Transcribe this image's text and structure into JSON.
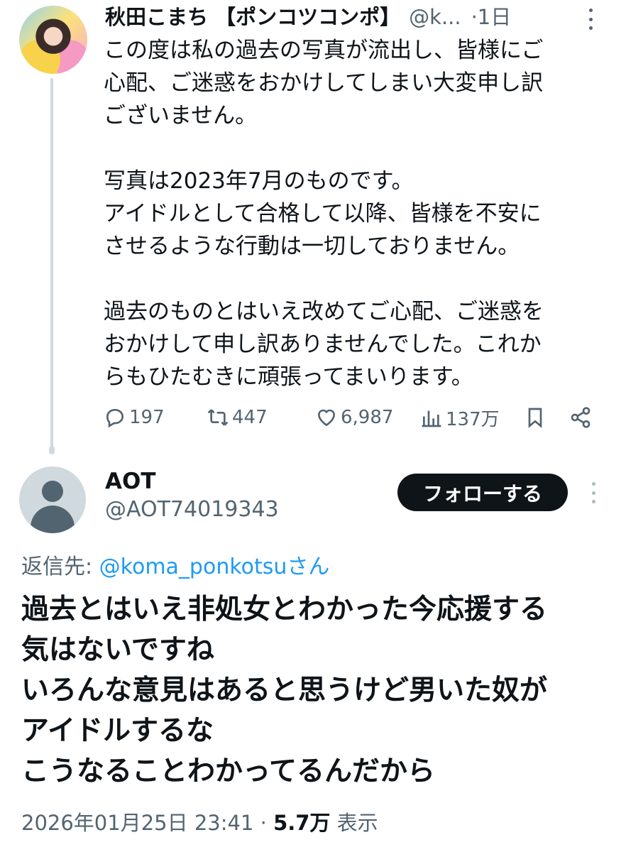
{
  "tweet1": {
    "author_name": "秋田こまち 【ポンコツコンポ】",
    "handle": "@k...",
    "time": "·1日",
    "paragraphs": [
      "この度は私の過去の写真が流出し、皆様にご",
      "心配、ご迷惑をおかけしてしまい大変申し訳",
      "ございません。",
      "",
      "写真は2023年7月のものです。",
      "アイドルとして合格して以降、皆様を不安に",
      "させるような行動は一切しておりません。",
      "",
      "過去のものとはいえ改めてご心配、ご迷惑を",
      "おかけして申し訳ありませんでした。これか",
      "らもひたむきに頑張ってまいります。"
    ],
    "replies": "197",
    "reposts": "447",
    "likes": "6,987",
    "views": "137万"
  },
  "tweet2": {
    "author_name": "AOT",
    "handle": "@AOT74019343",
    "follow_label": "フォローする",
    "reply_prefix": "返信先: ",
    "reply_mention": "@koma_ponkotsu",
    "reply_suffix": "さん",
    "lines": [
      "過去とはいえ非処女とわかった今応援する",
      "気はないですね",
      "いろんな意見はあると思うけど男いた奴が",
      "アイドルするな",
      "こうなることわかってるんだから"
    ],
    "timestamp": "2026年01月25日 23:41 · ",
    "views_count": "5.7万",
    "views_label": " 表示"
  },
  "icons": [
    "reply-icon",
    "repost-icon",
    "like-icon",
    "views-icon",
    "bookmark-icon",
    "share-icon",
    "more-icon"
  ]
}
